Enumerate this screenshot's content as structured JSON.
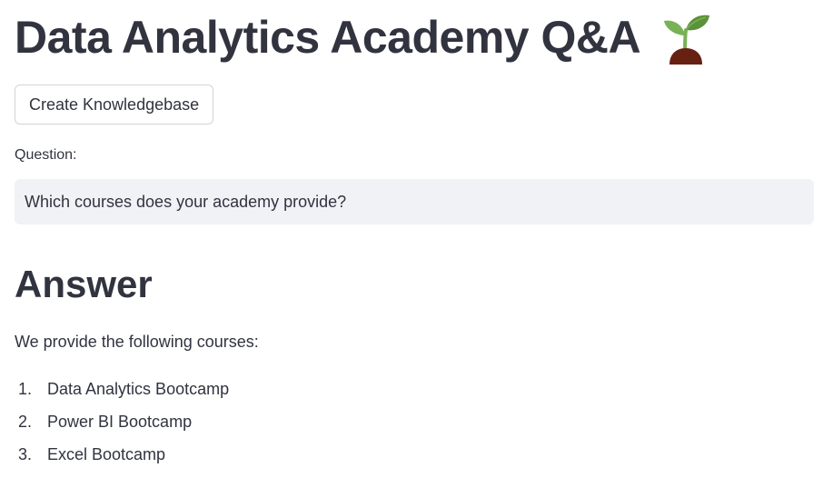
{
  "header": {
    "title": "Data Analytics Academy Q&A",
    "emoji_icon": "seedling-icon"
  },
  "actions": {
    "create_kb_label": "Create Knowledgebase"
  },
  "question": {
    "label": "Question:",
    "value": "Which courses does your academy provide?"
  },
  "answer": {
    "heading": "Answer",
    "intro": "We provide the following courses:",
    "courses": [
      {
        "num": "1.",
        "name": "Data Analytics Bootcamp"
      },
      {
        "num": "2.",
        "name": "Power BI Bootcamp"
      },
      {
        "num": "3.",
        "name": "Excel Bootcamp"
      }
    ]
  },
  "colors": {
    "text": "#31333f",
    "input_bg": "#f0f2f6",
    "button_border": "#d3d4d8",
    "seedling_leaf": "#77b255",
    "seedling_soil": "#662113"
  }
}
